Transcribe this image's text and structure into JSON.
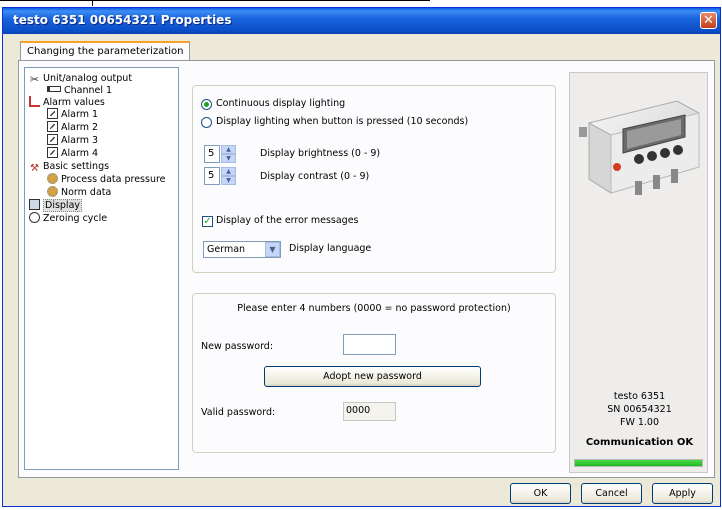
{
  "window": {
    "title": "testo 6351  00654321 Properties",
    "close_glyph": "✕"
  },
  "tab": {
    "label": "Changing the parameterization"
  },
  "tree": {
    "items": [
      {
        "label": "Unit/analog output",
        "icon": "unit-output-icon"
      },
      {
        "label": "Channel 1",
        "icon": "channel-icon"
      },
      {
        "label": "Alarm values",
        "icon": "alarm-values-icon"
      },
      {
        "label": "Alarm 1",
        "icon": "alarm-icon"
      },
      {
        "label": "Alarm 2",
        "icon": "alarm-icon"
      },
      {
        "label": "Alarm 3",
        "icon": "alarm-icon"
      },
      {
        "label": "Alarm 4",
        "icon": "alarm-icon"
      },
      {
        "label": "Basic settings",
        "icon": "basic-settings-icon"
      },
      {
        "label": "Process data pressure",
        "icon": "gear-icon"
      },
      {
        "label": "Norm data",
        "icon": "gear-icon"
      },
      {
        "label": "Display",
        "icon": "display-icon",
        "selected": true
      },
      {
        "label": "Zeroing cycle",
        "icon": "clock-icon"
      }
    ]
  },
  "display": {
    "radio_continuous": "Continuous display lighting",
    "radio_button": "Display lighting when button is pressed (10 seconds)",
    "radio_selected": "continuous",
    "brightness_value": "5",
    "brightness_label": "Display brightness (0 - 9)",
    "contrast_value": "5",
    "contrast_label": "Display contrast (0 - 9)",
    "error_msg_label": "Display of the error messages",
    "error_msg_checked": true,
    "language_value": "German",
    "language_label": "Display language"
  },
  "password": {
    "hint": "Please enter 4 numbers (0000 = no password protection)",
    "new_label": "New password:",
    "new_value": "",
    "adopt_button": "Adopt new password",
    "valid_label": "Valid password:",
    "valid_value": "0000"
  },
  "device": {
    "model": "testo 6351",
    "serial": "SN 00654321",
    "firmware": "FW 1.00",
    "status": "Communication OK",
    "status_progress_percent": 100,
    "status_color": "#2ecc2e"
  },
  "buttons": {
    "ok": "OK",
    "cancel": "Cancel",
    "apply": "Apply"
  }
}
